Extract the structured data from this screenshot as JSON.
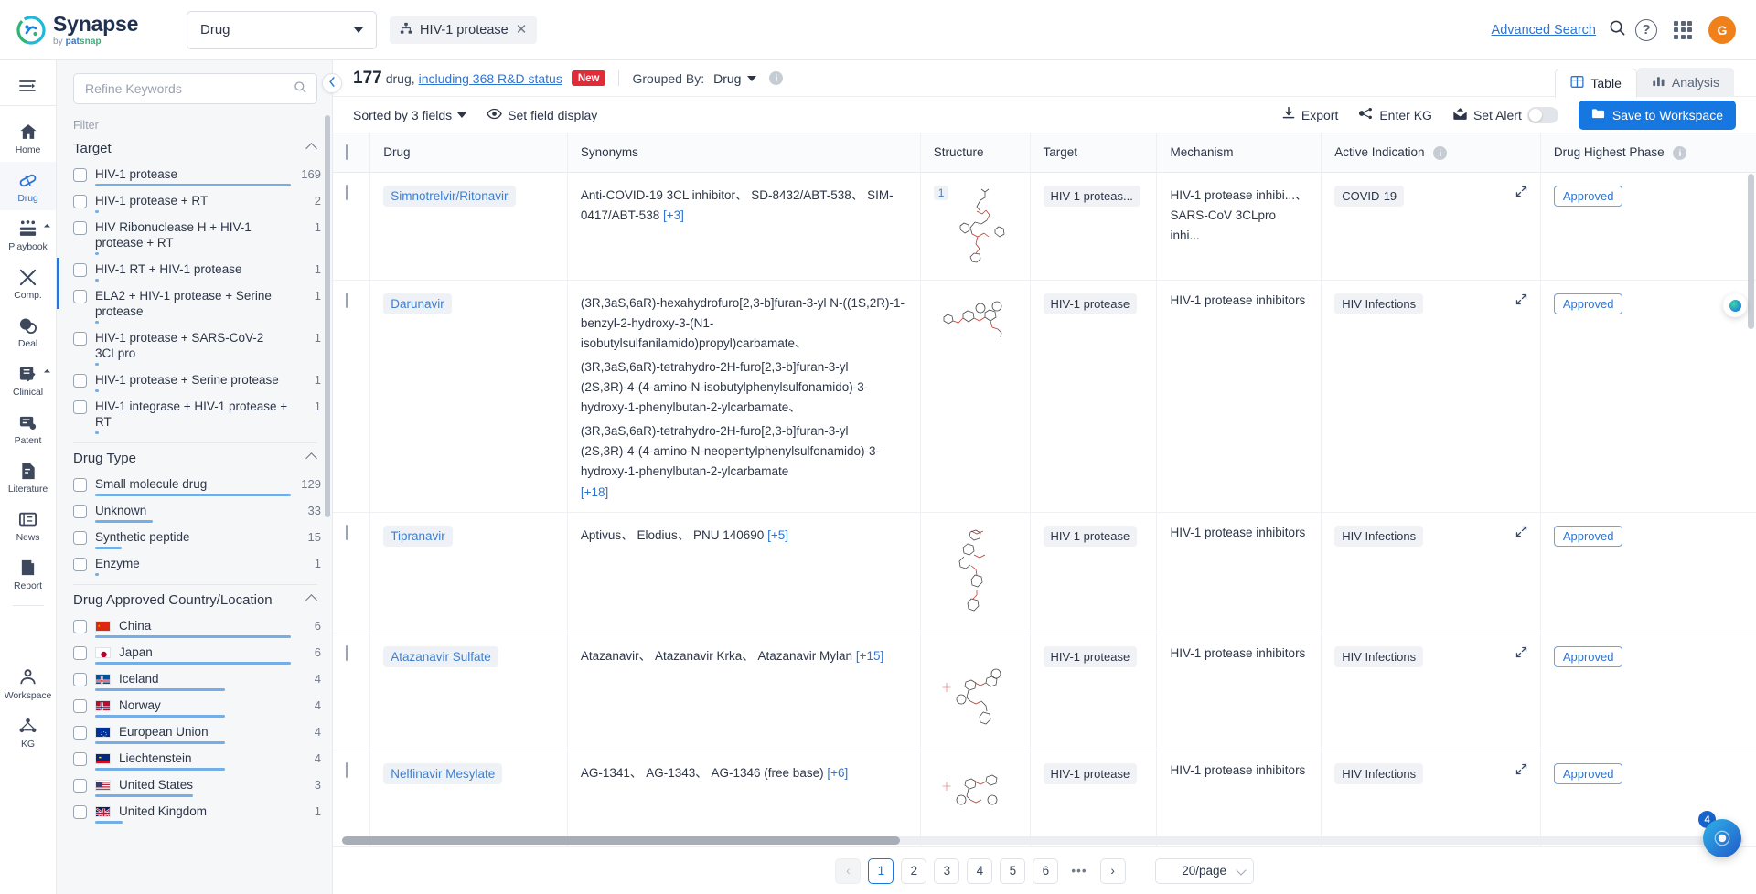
{
  "brand": {
    "name": "Synapse",
    "tagline_by": "by ",
    "tagline_pat": "pat",
    "tagline_snap": "snap",
    "accent": "#1677e0"
  },
  "topbar": {
    "entity_select": "Drug",
    "search_chip": "HIV-1 protease",
    "chip_close": "✕",
    "advanced_search": "Advanced Search",
    "search_icon": "search-icon",
    "help_icon": "?",
    "avatar_initial": "G"
  },
  "rail": {
    "collapse_label": "collapse-sidebar",
    "items": [
      {
        "label": "Home",
        "icon": "home-icon"
      },
      {
        "label": "Drug",
        "icon": "pill-icon",
        "active": true
      },
      {
        "label": "Playbook",
        "icon": "playbook-icon",
        "has_sub": true
      },
      {
        "label": "Comp.",
        "icon": "competition-icon"
      },
      {
        "label": "Deal",
        "icon": "deal-icon"
      },
      {
        "label": "Clinical",
        "icon": "clinical-icon",
        "has_sub": true
      },
      {
        "label": "Patent",
        "icon": "patent-icon"
      },
      {
        "label": "Literature",
        "icon": "literature-icon"
      },
      {
        "label": "News",
        "icon": "news-icon"
      },
      {
        "label": "Report",
        "icon": "report-icon"
      }
    ],
    "bottom_items": [
      {
        "label": "Workspace",
        "icon": "workspace-icon"
      },
      {
        "label": "KG",
        "icon": "kg-icon"
      }
    ]
  },
  "filters": {
    "refine_placeholder": "Refine Keywords",
    "filter_label": "Filter",
    "groups": [
      {
        "title": "Target",
        "options": [
          {
            "name": "HIV-1 protease",
            "count": "169",
            "bar": 100
          },
          {
            "name": "HIV-1 protease + RT",
            "count": "2",
            "bar": 3
          },
          {
            "name": "HIV Ribonuclease H + HIV-1 protease + RT",
            "count": "1",
            "bar": 2
          },
          {
            "name": "HIV-1 RT + HIV-1 protease",
            "count": "1",
            "bar": 2
          },
          {
            "name": "ELA2 + HIV-1 protease + Serine protease",
            "count": "1",
            "bar": 2
          },
          {
            "name": "HIV-1 protease + SARS-CoV-2 3CLpro",
            "count": "1",
            "bar": 2
          },
          {
            "name": "HIV-1 protease + Serine protease",
            "count": "1",
            "bar": 2
          },
          {
            "name": "HIV-1 integrase + HIV-1 protease + RT",
            "count": "1",
            "bar": 2
          }
        ]
      },
      {
        "title": "Drug Type",
        "options": [
          {
            "name": "Small molecule drug",
            "count": "129",
            "bar": 100
          },
          {
            "name": "Unknown",
            "count": "33",
            "bar": 62
          },
          {
            "name": "Synthetic peptide",
            "count": "15",
            "bar": 28
          },
          {
            "name": "Enzyme",
            "count": "1",
            "bar": 2
          }
        ]
      },
      {
        "title": "Drug Approved Country/Location",
        "options": [
          {
            "name": "China",
            "count": "6",
            "bar": 100,
            "flag": "cn"
          },
          {
            "name": "Japan",
            "count": "6",
            "bar": 100,
            "flag": "jp"
          },
          {
            "name": "Iceland",
            "count": "4",
            "bar": 66,
            "flag": "is"
          },
          {
            "name": "Norway",
            "count": "4",
            "bar": 66,
            "flag": "no"
          },
          {
            "name": "European Union",
            "count": "4",
            "bar": 66,
            "flag": "eu"
          },
          {
            "name": "Liechtenstein",
            "count": "4",
            "bar": 66,
            "flag": "li"
          },
          {
            "name": "United States",
            "count": "3",
            "bar": 50,
            "flag": "us"
          },
          {
            "name": "United Kingdom",
            "count": "1",
            "bar": 17,
            "flag": "gb"
          }
        ]
      }
    ]
  },
  "results_header": {
    "count": "177",
    "count_suffix": "drug,",
    "rd_status_link": "including 368 R&D status",
    "new_badge": "New",
    "grouped_by_label": "Grouped By:",
    "grouped_by_value": "Drug",
    "info_icon": "i"
  },
  "view_tabs": [
    {
      "label": "Table",
      "icon": "table-icon",
      "selected": true
    },
    {
      "label": "Analysis",
      "icon": "bar-chart-icon",
      "selected": false
    }
  ],
  "toolbar": {
    "sorted_by": "Sorted by 3 fields",
    "set_field_display": "Set field display",
    "export": "Export",
    "enter_kg": "Enter KG",
    "set_alert": "Set Alert",
    "save_to_workspace": "Save to Workspace",
    "alert_toggle_on": false
  },
  "table": {
    "columns": [
      {
        "label": "Drug",
        "info": false
      },
      {
        "label": "Synonyms",
        "info": false
      },
      {
        "label": "Structure",
        "info": false
      },
      {
        "label": "Target",
        "info": false
      },
      {
        "label": "Mechanism",
        "info": false
      },
      {
        "label": "Active Indication",
        "info": true
      },
      {
        "label": "Drug Highest Phase",
        "info": true
      }
    ],
    "rows": [
      {
        "drug": "Simnotrelvir/Ritonavir",
        "synonyms": [
          "Anti-COVID-19 3CL inhibitor、",
          "SD-8432/ABT-538、",
          "SIM-0417/ABT-538"
        ],
        "synonyms_more": "[+3]",
        "structure_index": "1",
        "target": "HIV-1 proteas...",
        "mechanism": [
          "HIV-1 protease inhibi...、",
          "SARS-CoV 3CLpro inhi..."
        ],
        "active_indication": "COVID-19",
        "phase": "Approved"
      },
      {
        "drug": "Darunavir",
        "synonyms": [
          "(3R,3aS,6aR)-hexahydrofuro[2,3-b]furan-3-yl N-((1S,2R)-1-benzyl-2-hydroxy-3-(N1-isobutylsulfanilamido)propyl)carbamate、",
          "(3R,3aS,6aR)-tetrahydro-2H-furo[2,3-b]furan-3-yl (2S,3R)-4-(4-amino-N-isobutylphenylsulfonamido)-3-hydroxy-1-phenylbutan-2-ylcarbamate、",
          "(3R,3aS,6aR)-tetrahydro-2H-furo[2,3-b]furan-3-yl (2S,3R)-4-(4-amino-N-neopentylphenylsulfonamido)-3-hydroxy-1-phenylbutan-2-ylcarbamate"
        ],
        "synonyms_more": "[+18]",
        "structure_index": "",
        "target": "HIV-1 protease",
        "mechanism": [
          "HIV-1 protease inhibitors"
        ],
        "active_indication": "HIV Infections",
        "phase": "Approved"
      },
      {
        "drug": "Tipranavir",
        "synonyms": [
          "Aptivus、",
          "Elodius、",
          "PNU 140690"
        ],
        "synonyms_more": "[+5]",
        "structure_index": "",
        "target": "HIV-1 protease",
        "mechanism": [
          "HIV-1 protease inhibitors"
        ],
        "active_indication": "HIV Infections",
        "phase": "Approved"
      },
      {
        "drug": "Atazanavir Sulfate",
        "synonyms": [
          "Atazanavir、",
          "Atazanavir Krka、",
          "Atazanavir Mylan"
        ],
        "synonyms_more": "[+15]",
        "structure_index": "",
        "target": "HIV-1 protease",
        "mechanism": [
          "HIV-1 protease inhibitors"
        ],
        "active_indication": "HIV Infections",
        "phase": "Approved"
      },
      {
        "drug": "Nelfinavir Mesylate",
        "synonyms": [
          "AG-1341、",
          "AG-1343、",
          "AG-1346 (free base)"
        ],
        "synonyms_more": "[+6]",
        "structure_index": "",
        "target": "HIV-1 protease",
        "mechanism": [
          "HIV-1 protease inhibitors"
        ],
        "active_indication": "HIV Infections",
        "phase": "Approved"
      }
    ]
  },
  "pagination": {
    "prev": "‹",
    "next": "›",
    "pages": [
      "1",
      "2",
      "3",
      "4",
      "5",
      "6"
    ],
    "dots": "•••",
    "current": "1",
    "page_size": "20/page"
  },
  "floating": {
    "assistant_badge": "4",
    "orb_icon": "ai-orb-icon",
    "ai_icon": "ai-assistant-icon"
  }
}
